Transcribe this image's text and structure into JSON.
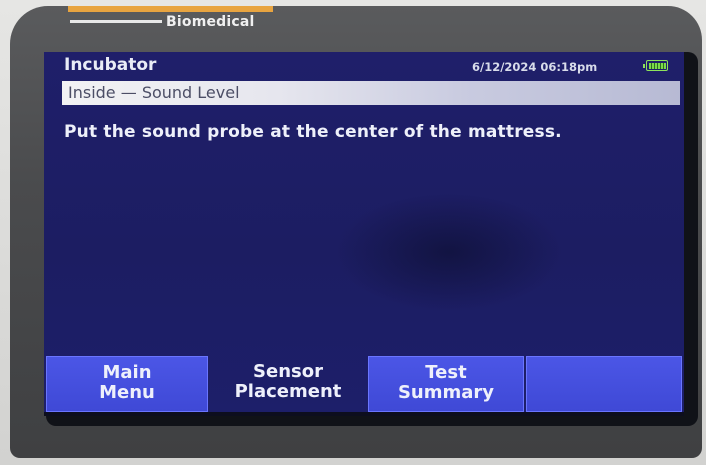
{
  "device": {
    "brand": "Biomedical"
  },
  "header": {
    "title": "Incubator",
    "datetime": "6/12/2024 06:18pm",
    "battery_icon": "battery-full-icon",
    "battery_color": "#8ee35c"
  },
  "subheader": {
    "label": "Inside — Sound Level"
  },
  "content": {
    "instruction": "Put the sound probe at the center of the mattress."
  },
  "softkeys": [
    {
      "line1": "Main",
      "line2": "Menu"
    },
    {
      "line1": "Sensor",
      "line2": "Placement"
    },
    {
      "line1": "Test",
      "line2": "Summary"
    },
    {
      "line1": "",
      "line2": ""
    }
  ],
  "colors": {
    "screen_background": "#1f1f6a",
    "softkey_blue": "#4b56e6"
  }
}
